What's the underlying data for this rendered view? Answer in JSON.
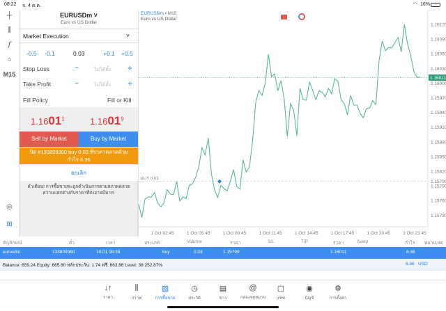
{
  "status": {
    "time": "08:22",
    "date": "จ. 4 ต.ค.",
    "battery": "16%"
  },
  "toolbar": {
    "timeframe": "M15"
  },
  "order": {
    "symbol": "EURUSDm",
    "description": "Euro vs US Dollar",
    "execution": "Market Execution",
    "vol_steps": [
      "-0.5",
      "-0.1",
      "+0.1",
      "+0.5"
    ],
    "volume": "0.03",
    "stop_loss_label": "Stop Loss",
    "take_profit_label": "Take Profit",
    "not_set": "ไม่ได้ตั้ง",
    "fill_policy_label": "Fill Policy",
    "fill_policy_value": "Fill or Kill",
    "bid": {
      "prefix": "1.16",
      "big": "01",
      "sup": "1"
    },
    "ask": {
      "prefix": "1.16",
      "big": "01",
      "sup": "9"
    },
    "sell_label": "Sell by Market",
    "buy_label": "Buy by Market",
    "close_label": "ปิด #133809360 buy 0.03 ที่ราคาตลาดด้วยกำไร 6.36",
    "cancel_label": "ยกเลิก",
    "warning": "คำเตือน! การซื้อขายจะถูกดำเนินการตามสภาพตลาด ความแตกต่างกับราคาที่ส่งอาจมีมาก!"
  },
  "chart": {
    "symbol": "EURUSDm",
    "timeframe": "• M15",
    "description": "Euro vs US Dollar",
    "line_color": "#5cb894",
    "current_price": "1.16011",
    "buy_label": "BUY 0.03",
    "buy_price": "1.15799",
    "price_ticks": [
      "1.16120",
      "1.16090",
      "1.16060",
      "1.16030",
      "1.16000",
      "1.15970",
      "1.15940",
      "1.15910",
      "1.15880",
      "1.15850",
      "1.15820",
      "1.15790",
      "1.15760",
      "1.15730"
    ],
    "time_ticks": [
      "1 Oct 02:45",
      "1 Oct 05:45",
      "1 Oct 08:45",
      "1 Oct 11:45",
      "1 Oct 14:45",
      "1 Oct 17:45",
      "1 Oct 20:45",
      "3 Oct 23:45"
    ],
    "prices": [
      1.15753,
      1.15725,
      1.15763,
      1.15767,
      1.15767,
      1.15776,
      1.15755,
      1.15747,
      1.15755,
      1.15782,
      1.15773,
      1.15772,
      1.15799,
      1.15759,
      1.15767,
      1.15764,
      1.15791,
      1.15794,
      1.15807,
      1.15828,
      1.15868,
      1.15853,
      1.15888,
      1.15814,
      1.15782,
      1.15766,
      1.15791,
      1.15784,
      1.1578,
      1.158,
      1.15823,
      1.15789,
      1.15783,
      1.15843,
      1.15818,
      1.15828,
      1.15881,
      1.15961,
      1.15985,
      1.15975,
      1.15999,
      1.16059,
      1.16013,
      1.16019,
      1.15984,
      1.16005,
      1.15968,
      1.15891,
      1.15958,
      1.15945,
      1.15892,
      1.15989,
      1.15966,
      1.15965,
      1.16002,
      1.15985,
      1.15966,
      1.15984,
      1.15981,
      1.15972,
      1.15989,
      1.15978,
      1.16009,
      1.16003,
      1.15966,
      1.15958,
      1.15935,
      1.15975,
      1.15955,
      1.15955,
      1.15938,
      1.15929,
      1.15948,
      1.15949,
      1.15964,
      1.15956,
      1.16046,
      1.16086,
      1.16066,
      1.16073,
      1.16072,
      1.16083,
      1.16093,
      1.16064,
      1.1612,
      1.1608,
      1.16056,
      1.16023,
      1.16012,
      1.16012
    ]
  },
  "table": {
    "headers": [
      "สัญลักษณ์",
      "ตั๋ว",
      "เวลา",
      "ประเภท",
      "Volume",
      "ราคา",
      "S/L",
      "T/P",
      "ราคา",
      "Swap",
      "กำไร",
      "หมายเหตุ"
    ],
    "row": {
      "symbol": "eurusdm",
      "ticket": "133809360",
      "time": "10.01 08:36",
      "type": "buy",
      "volume": "0.03",
      "open_price": "1.15799",
      "current_price": "1.16011",
      "profit": "6.36"
    },
    "balance": "Balance: 659.24 Equity: 665.60 หลักประกัน: 1.74 ฟรี: 663.86 Level: 38 252.87%",
    "total_profit": "6.36",
    "currency": "USD"
  },
  "nav": [
    {
      "label": "ราคา",
      "icon": "↓↑"
    },
    {
      "label": "กราฟ",
      "icon": "⫼"
    },
    {
      "label": "การซื้อขาย",
      "icon": "📈"
    },
    {
      "label": "ประวัติ",
      "icon": "◷"
    },
    {
      "label": "ข่าว",
      "icon": "▤"
    },
    {
      "label": "กล่องจดหมาย",
      "icon": "@"
    },
    {
      "label": "แชท",
      "icon": "▢"
    },
    {
      "label": "บัญชี",
      "icon": "◉"
    },
    {
      "label": "การตั้งค่า",
      "icon": "⚙"
    }
  ]
}
